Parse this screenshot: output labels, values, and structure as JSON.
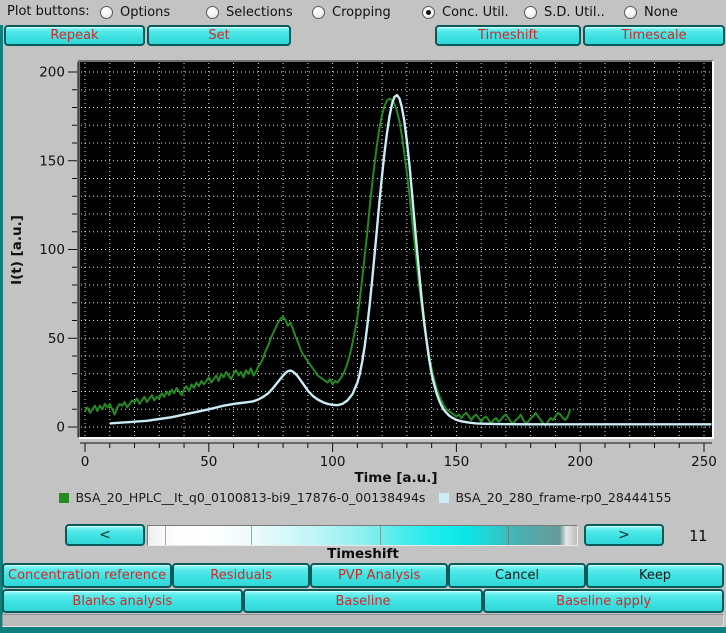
{
  "colors": {
    "window_bg": "#0d7f7f",
    "panel_gray": "#c3c3c3",
    "button_fill": "#3fe2e2",
    "button_border": "#0b5a5a",
    "button_text_red": "#d32727",
    "button_text_black": "#151515",
    "canvas_bg": "#000000",
    "grid": "#ffffff"
  },
  "plot_buttons_row": {
    "label": "Plot buttons:",
    "options": [
      {
        "label": "Options",
        "selected": false
      },
      {
        "label": "Selections",
        "selected": false
      },
      {
        "label": "Cropping",
        "selected": false
      },
      {
        "label": "Conc. Util.",
        "selected": true
      },
      {
        "label": "S.D. Util..",
        "selected": false
      },
      {
        "label": "None",
        "selected": false
      }
    ]
  },
  "toolbar": {
    "repeak": "Repeak",
    "set": "Set",
    "timeshift": "Timeshift",
    "timescale": "Timescale"
  },
  "chart_data": {
    "type": "line",
    "title": "",
    "xlabel": "Time [a.u.]",
    "ylabel": "I(t) [a.u.]",
    "xlim": [
      0,
      250
    ],
    "ylim": [
      0,
      200
    ],
    "x_major_step": 50,
    "x_minor_step": 10,
    "y_major_step": 50,
    "y_minor_step": 10,
    "grid": "dotted white minor grid every 10 units, black canvas",
    "legend_position": "bottom",
    "series": [
      {
        "name": "BSA_20_HPLC__It_q0_0100813-bi9_17876-0_00138494s",
        "color": "#228b22",
        "style": "noisy experimental trace",
        "t_start": 0,
        "t_step": 1,
        "values": [
          9,
          11,
          8,
          10,
          12,
          9,
          12,
          10,
          13,
          11,
          13,
          10,
          7,
          11,
          13,
          12,
          14,
          11,
          13,
          15,
          14,
          16,
          13,
          15,
          17,
          14,
          16,
          18,
          15,
          17,
          16,
          19,
          17,
          20,
          18,
          21,
          19,
          22,
          20,
          18,
          21,
          23,
          20,
          24,
          22,
          25,
          23,
          26,
          24,
          26,
          28,
          25,
          27,
          29,
          26,
          30,
          28,
          31,
          29,
          27,
          30,
          32,
          29,
          31,
          28,
          32,
          30,
          33,
          29,
          31,
          34,
          36,
          39,
          43,
          46,
          50,
          53,
          56,
          59,
          61,
          62,
          60,
          57,
          59,
          55,
          51,
          48,
          44,
          41,
          39,
          37,
          35,
          33,
          31,
          29,
          28,
          27,
          26,
          25,
          27,
          24,
          26,
          25,
          27,
          29,
          32,
          36,
          41,
          47,
          54,
          62,
          72,
          84,
          97,
          110,
          124,
          137,
          149,
          160,
          169,
          176,
          181,
          184,
          185,
          184,
          182,
          178,
          172,
          164,
          154,
          143,
          131,
          118,
          105,
          92,
          79,
          68,
          57,
          48,
          40,
          33,
          27,
          22,
          18,
          15,
          12,
          10,
          9,
          8,
          7,
          6,
          7,
          5,
          7,
          8,
          6,
          4,
          6,
          7,
          5,
          3,
          5,
          6,
          4,
          2,
          4,
          5,
          3,
          4,
          6,
          7,
          5,
          3,
          2,
          4,
          5,
          7,
          4,
          2,
          3,
          5,
          6,
          8,
          6,
          4,
          2,
          1,
          3,
          5,
          4,
          6,
          8,
          7,
          5,
          4,
          6,
          10
        ]
      },
      {
        "name": "BSA_20_280_frame-rp0_28444155",
        "color": "#c9ecf5",
        "style": "smooth reference trace",
        "points": [
          [
            10,
            2
          ],
          [
            15,
            2.5
          ],
          [
            20,
            3
          ],
          [
            25,
            3.5
          ],
          [
            30,
            4.5
          ],
          [
            35,
            5.5
          ],
          [
            40,
            7
          ],
          [
            45,
            8.5
          ],
          [
            50,
            10
          ],
          [
            53,
            11
          ],
          [
            56,
            12
          ],
          [
            60,
            13
          ],
          [
            63,
            13.5
          ],
          [
            66,
            14
          ],
          [
            68,
            14.5
          ],
          [
            70,
            15.5
          ],
          [
            72,
            17
          ],
          [
            74,
            19
          ],
          [
            76,
            22
          ],
          [
            78,
            25.5
          ],
          [
            80,
            29
          ],
          [
            81,
            30.5
          ],
          [
            82,
            31.5
          ],
          [
            83,
            31.8
          ],
          [
            84,
            31.2
          ],
          [
            85,
            30
          ],
          [
            86,
            28.5
          ],
          [
            87,
            26.5
          ],
          [
            88,
            24.5
          ],
          [
            90,
            20.5
          ],
          [
            92,
            17.5
          ],
          [
            94,
            15.5
          ],
          [
            96,
            14
          ],
          [
            98,
            13
          ],
          [
            100,
            12.5
          ],
          [
            102,
            12.3
          ],
          [
            104,
            13
          ],
          [
            106,
            15
          ],
          [
            108,
            18.5
          ],
          [
            110,
            25
          ],
          [
            111,
            30
          ],
          [
            112,
            37
          ],
          [
            113,
            46
          ],
          [
            114,
            57
          ],
          [
            115,
            69
          ],
          [
            116,
            83
          ],
          [
            117,
            98
          ],
          [
            118,
            113
          ],
          [
            119,
            128
          ],
          [
            120,
            142
          ],
          [
            121,
            155
          ],
          [
            122,
            166
          ],
          [
            123,
            175
          ],
          [
            124,
            182
          ],
          [
            125,
            186
          ],
          [
            126,
            187
          ],
          [
            127,
            185
          ],
          [
            128,
            180
          ],
          [
            129,
            172
          ],
          [
            130,
            161
          ],
          [
            131,
            148
          ],
          [
            132,
            133
          ],
          [
            133,
            117
          ],
          [
            134,
            101
          ],
          [
            135,
            86
          ],
          [
            136,
            72
          ],
          [
            137,
            59
          ],
          [
            138,
            48
          ],
          [
            139,
            38
          ],
          [
            140,
            30
          ],
          [
            141,
            24
          ],
          [
            142,
            19
          ],
          [
            143,
            15
          ],
          [
            144,
            12
          ],
          [
            145,
            9.5
          ],
          [
            146,
            8
          ],
          [
            147,
            6.5
          ],
          [
            148,
            5.5
          ],
          [
            150,
            4
          ],
          [
            152,
            3.2
          ],
          [
            155,
            2.5
          ],
          [
            158,
            2
          ],
          [
            162,
            1.8
          ],
          [
            170,
            1.6
          ],
          [
            180,
            1.5
          ],
          [
            190,
            1.5
          ],
          [
            200,
            1.5
          ],
          [
            210,
            1.5
          ],
          [
            220,
            1.5
          ],
          [
            230,
            1.5
          ],
          [
            240,
            1.5
          ],
          [
            250,
            1.5
          ],
          [
            253,
            1.5
          ]
        ]
      }
    ]
  },
  "legend": [
    {
      "label": "BSA_20_HPLC__It_q0_0100813-bi9_17876-0_00138494s",
      "color": "#228b22"
    },
    {
      "label": "BSA_20_280_frame-rp0_28444155",
      "color": "#c9ecf5"
    }
  ],
  "timeshift_control": {
    "left": "<",
    "right": ">",
    "value": "11",
    "label": "Timeshift"
  },
  "actions_row1": [
    {
      "label": "Concentration reference",
      "text_color": "#d32727"
    },
    {
      "label": "Residuals",
      "text_color": "#d32727"
    },
    {
      "label": "PVP Analysis",
      "text_color": "#d32727"
    },
    {
      "label": "Cancel",
      "text_color": "#151515"
    },
    {
      "label": "Keep",
      "text_color": "#151515"
    }
  ],
  "actions_row2": [
    {
      "label": "Blanks analysis",
      "text_color": "#d32727"
    },
    {
      "label": "Baseline",
      "text_color": "#d32727"
    },
    {
      "label": "Baseline apply",
      "text_color": "#d32727"
    }
  ]
}
